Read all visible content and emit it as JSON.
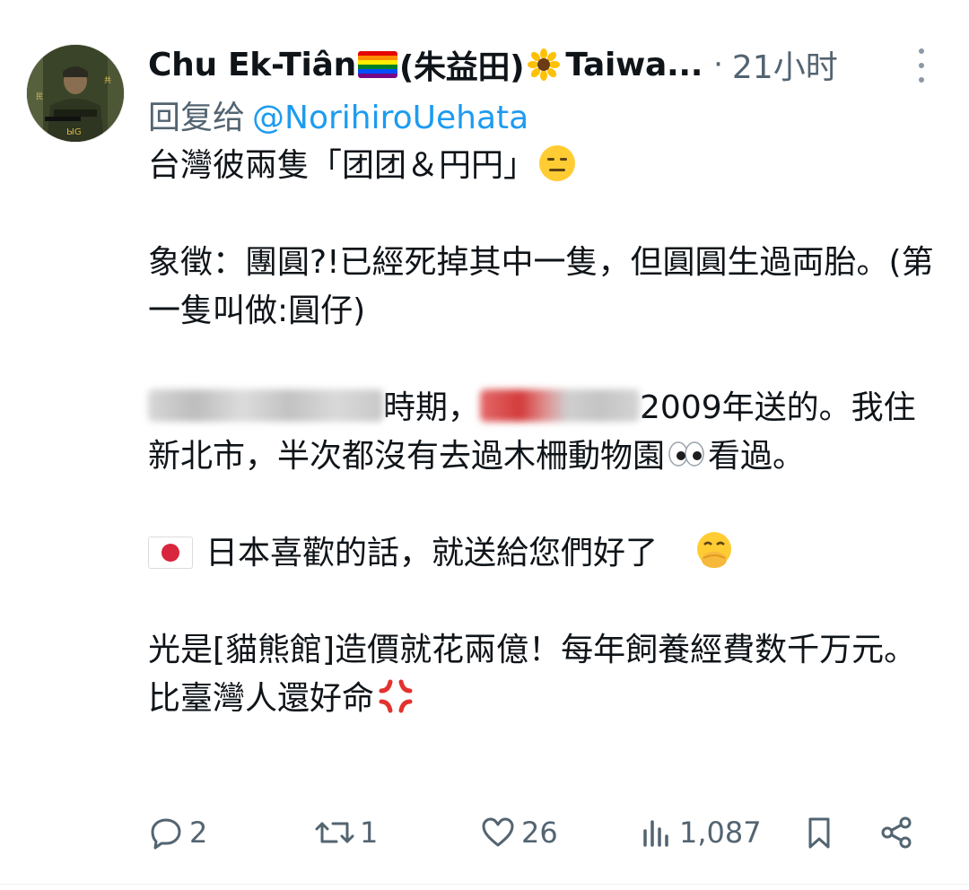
{
  "tweet": {
    "author": {
      "name": "Chu Ek-Tiân",
      "native_name": "(朱益田)",
      "name_suffix": "Taiwa...",
      "avatar_icon": "avatar-soldier-icon"
    },
    "separator": "·",
    "timestamp": "21小时",
    "reply_label": "回复给",
    "reply_handle": "@NorihiroUehata",
    "body": {
      "p1": "台灣彼兩隻「团团＆円円」",
      "p2": "象徵：團圓?!已經死掉其中一隻，但圓圓生過両胎。(第一隻叫做:圓仔)",
      "p3_a": "時期，",
      "p3_b": "2009年送的。我住新北市，半次都沒有去過木柵動物園",
      "p3_c": "看過。",
      "p4": "日本喜歡的話，就送給您們好了",
      "p5": "光是[貓熊館]造價就花兩億！每年飼養經費数千万元。比臺灣人還好命"
    },
    "stats": {
      "replies": "2",
      "reposts": "1",
      "likes": "26",
      "views": "1,087"
    },
    "colors": {
      "text": "#0f1419",
      "secondary": "#536471",
      "link": "#1d9bf0"
    }
  }
}
